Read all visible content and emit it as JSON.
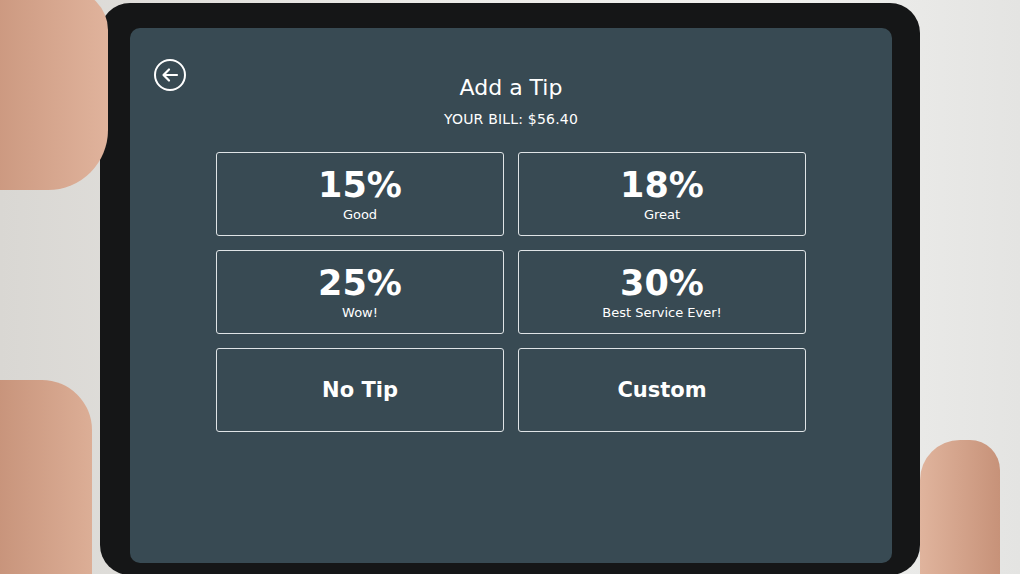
{
  "screen": {
    "title": "Add a Tip",
    "bill": "YOUR BILL: $56.40"
  },
  "options": [
    {
      "label": "15%",
      "caption": "Good",
      "selected": false
    },
    {
      "label": "18%",
      "caption": "Great",
      "selected": false
    },
    {
      "label": "25%",
      "caption": "Wow!",
      "selected": false
    },
    {
      "label": "30%",
      "caption": "Best Service Ever!",
      "selected": false
    },
    {
      "label": "No Tip",
      "caption": "",
      "selected": false
    },
    {
      "label": "Custom",
      "caption": "",
      "selected": false
    }
  ]
}
